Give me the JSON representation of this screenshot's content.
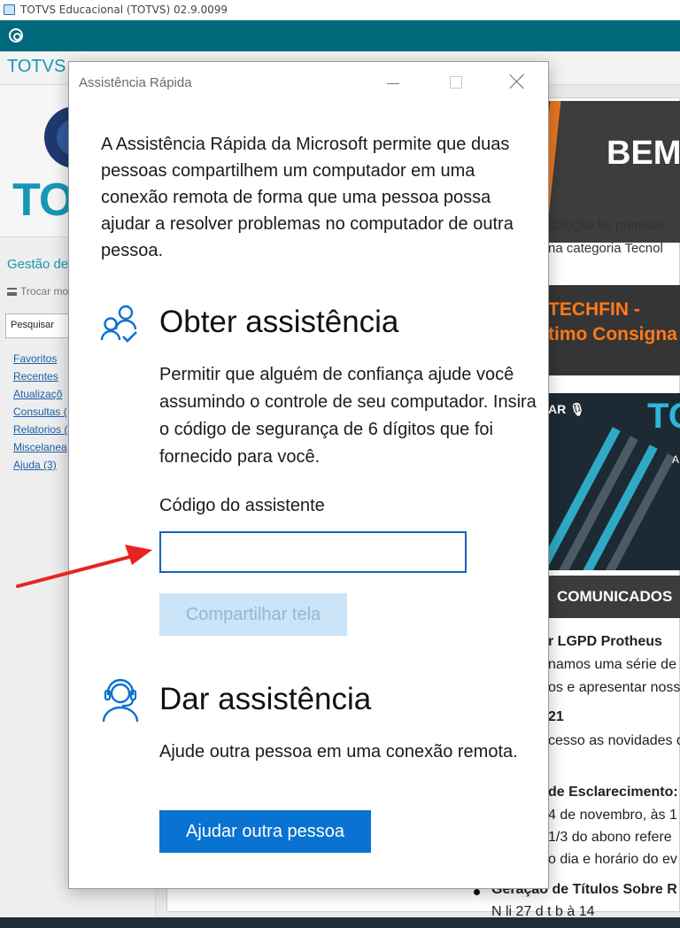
{
  "window": {
    "title": "TOTVS Educacional (TOTVS) 02.9.0099",
    "brand_header": "TOTVS"
  },
  "sidebar": {
    "logo_text": "TOTVS",
    "module_title": "Gestão de",
    "switch_label": "Trocar mo",
    "search_value": "Pesquisar",
    "items": [
      {
        "label": "Favoritos"
      },
      {
        "label": "Recentes"
      },
      {
        "label": "Atualizaçõ"
      },
      {
        "label": "Consultas ("
      },
      {
        "label": "Relatorios ("
      },
      {
        "label": "Miscelanea"
      },
      {
        "label": "Ajuda (3)"
      }
    ]
  },
  "content": {
    "banner1_text": "BEM",
    "caption1": "solução foi premiad",
    "caption2": "na categoria Tecnol",
    "banner2_line1": "TECHFIN -",
    "banner2_line2": "timo Consigna",
    "banner3_tag": "AR",
    "banner3_big": "TO",
    "banner3_small": "A",
    "comunicados": "COMUNICADOS",
    "news": [
      {
        "text": "r LGPD Protheus",
        "bold": true
      },
      {
        "text": "namos uma série de",
        "bold": false
      },
      {
        "text": "os e apresentar noss",
        "bold": false
      },
      {
        "text": "21",
        "bold": true
      },
      {
        "text": "cesso as novidades d",
        "bold": false
      },
      {
        "text": "de Esclarecimento: (",
        "bold": true
      },
      {
        "text": "4 de novembro, às 1",
        "bold": false
      },
      {
        "text": "1/3 do abono refere",
        "bold": false
      },
      {
        "text": "o dia e horário do ev",
        "bold": false
      },
      {
        "text": "Geração de Títulos Sobre R",
        "bold": true
      },
      {
        "text": "N   li  27 d   t  b    à  14",
        "bold": false
      }
    ]
  },
  "dialog": {
    "title": "Assistência Rápida",
    "intro": "A Assistência Rápida da Microsoft permite que duas pessoas compartilhem um computador em uma conexão remota de forma que uma pessoa possa ajudar a resolver problemas no computador de outra pessoa.",
    "get_help": {
      "heading": "Obter assistência",
      "description": "Permitir que alguém de confiança ajude você assumindo o controle de seu computador. Insira o código de segurança de 6 dígitos que foi fornecido para você.",
      "code_label": "Código do assistente",
      "code_value": "",
      "share_button": "Compartilhar tela"
    },
    "give_help": {
      "heading": "Dar assistência",
      "description": "Ajude outra pessoa em uma conexão remota.",
      "help_button": "Ajudar outra pessoa"
    },
    "colors": {
      "accent": "#0a72d0",
      "disabled_button": "#cce4f7",
      "input_border": "#1763b9"
    }
  },
  "annotation": {
    "arrow_color": "#e8231f"
  }
}
